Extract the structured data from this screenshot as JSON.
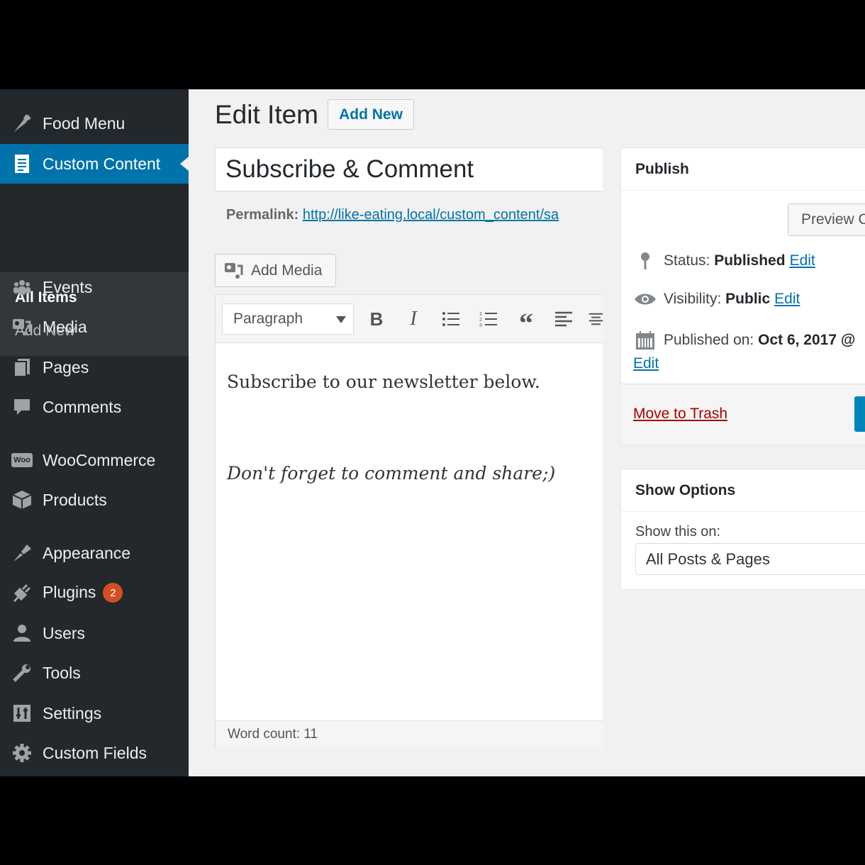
{
  "sidebar": {
    "items": [
      {
        "label": "Food Menu",
        "icon": "carrot-icon"
      },
      {
        "label": "Custom Content",
        "icon": "document-icon",
        "active": true
      },
      {
        "label": "Events",
        "icon": "groups-icon"
      },
      {
        "label": "Media",
        "icon": "media-icon"
      },
      {
        "label": "Pages",
        "icon": "pages-icon"
      },
      {
        "label": "Comments",
        "icon": "comment-icon"
      },
      {
        "label": "WooCommerce",
        "icon": "woo-icon"
      },
      {
        "label": "Products",
        "icon": "archive-icon"
      },
      {
        "label": "Appearance",
        "icon": "brush-icon"
      },
      {
        "label": "Plugins",
        "icon": "plugin-icon",
        "badge": "2"
      },
      {
        "label": "Users",
        "icon": "user-icon"
      },
      {
        "label": "Tools",
        "icon": "wrench-icon"
      },
      {
        "label": "Settings",
        "icon": "settings-sliders-icon"
      },
      {
        "label": "Custom Fields",
        "icon": "gear-icon"
      }
    ],
    "submenu": [
      "All Items",
      "Add New"
    ],
    "woo_icon_text": "Woo"
  },
  "header": {
    "title": "Edit Item",
    "add_new": "Add New"
  },
  "post": {
    "title": "Subscribe & Comment",
    "permalink_label": "Permalink:",
    "permalink_url": "http://like-eating.local/custom_content/sa"
  },
  "editor": {
    "add_media": "Add Media",
    "format": "Paragraph",
    "paragraph1": "Subscribe to our newsletter below.",
    "paragraph2": "Don't forget to comment and share;)",
    "word_count": "Word count: 11"
  },
  "publish": {
    "title": "Publish",
    "preview": "Preview C",
    "status_label": "Status:",
    "status_value": "Published",
    "visibility_label": "Visibility:",
    "visibility_value": "Public",
    "published_label": "Published on:",
    "published_value": "Oct 6, 2017 @",
    "edit": "Edit",
    "trash": "Move to Trash"
  },
  "show_options": {
    "title": "Show Options",
    "label": "Show this on:",
    "value": "All Posts & Pages"
  },
  "colors": {
    "sidebar": "#23282d",
    "active": "#0073aa",
    "link": "#0073aa",
    "badge": "#d54e21",
    "trash": "#a00"
  }
}
